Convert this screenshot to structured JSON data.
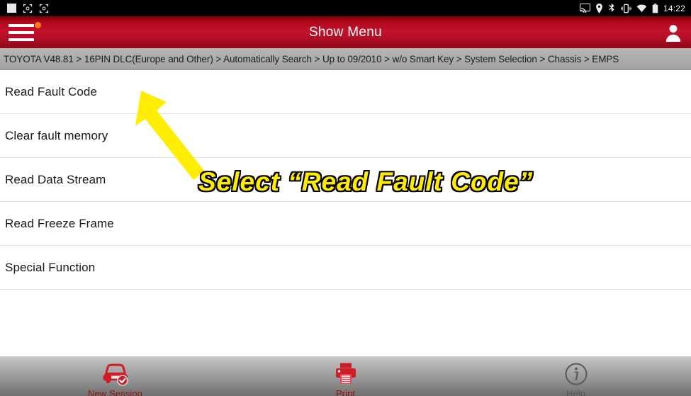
{
  "statusbar": {
    "time": "14:22",
    "left_icons": [
      "white-square-icon",
      "screenshot-icon",
      "screenshot-icon"
    ],
    "right_icons": [
      "cast-icon",
      "location-icon",
      "bluetooth-icon",
      "vibrate-icon",
      "wifi-icon",
      "battery-icon"
    ]
  },
  "titlebar": {
    "menu_icon": "hamburger-menu-icon",
    "badge": true,
    "title": "Show Menu",
    "user_icon": "user-account-icon",
    "color": "#c4122c"
  },
  "breadcrumb": {
    "path": "TOYOTA V48.81 > 16PIN DLC(Europe and Other) > Automatically Search > Up to 09/2010 > w/o Smart Key > System Selection > Chassis > EMPS"
  },
  "menu": {
    "items": [
      {
        "label": "Read Fault Code"
      },
      {
        "label": "Clear fault memory"
      },
      {
        "label": "Read Data Stream"
      },
      {
        "label": "Read Freeze Frame"
      },
      {
        "label": "Special Function"
      }
    ]
  },
  "annotation": {
    "text": "Select “Read Fault Code”",
    "text_color": "#ffeb00",
    "outline_color": "#000000",
    "arrow_color": "#ffee00",
    "arrow_points_to": "Read Fault Code"
  },
  "toolbar": {
    "items": [
      {
        "icon": "car-check-icon",
        "label": "New Session"
      },
      {
        "icon": "printer-icon",
        "label": "Print"
      },
      {
        "icon": "info-circle-icon",
        "label": "Help"
      }
    ]
  }
}
